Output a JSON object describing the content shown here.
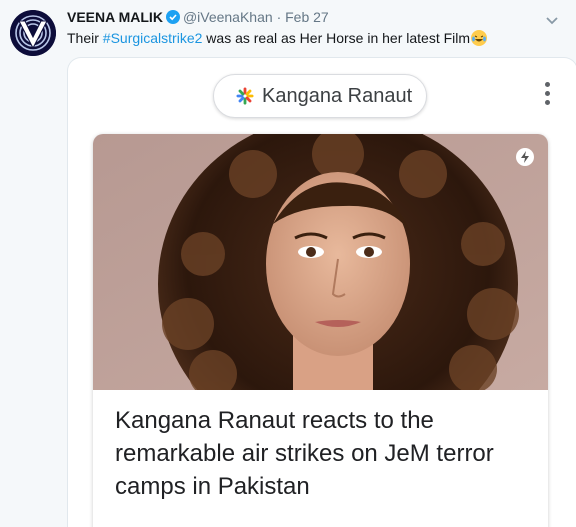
{
  "tweet": {
    "author_name": "VEENA MALIK",
    "handle": "@iVeenaKhan",
    "separator": "·",
    "date": "Feb 27",
    "text_before": "Their ",
    "hashtag": "#Surgicalstrike2",
    "text_after": " was as real as Her Horse in her latest Film"
  },
  "card": {
    "topic_chip": "Kangana Ranaut",
    "headline": "Kangana Ranaut reacts to the remarkable air strikes on JeM terror camps in Pakistan"
  },
  "colors": {
    "link_blue": "#1b95e0",
    "verified_blue": "#1da1f2",
    "muted_gray": "#657786"
  },
  "icons": {
    "verified": "verified-badge-icon",
    "caret": "chevron-down-icon",
    "emoji": "laughing-tears-emoji-icon",
    "chip": "google-sparkle-icon",
    "menu": "kebab-menu-icon",
    "amp": "lightning-amp-icon"
  }
}
